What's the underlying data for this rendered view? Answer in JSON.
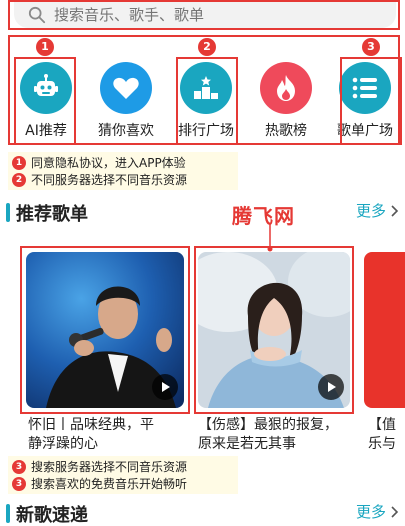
{
  "search": {
    "placeholder": "搜索音乐、歌手、歌单"
  },
  "categories": [
    {
      "label": "AI推荐",
      "badge": "1",
      "color": "#1aa6c0",
      "icon": "robot-icon"
    },
    {
      "label": "猜你喜欢",
      "badge": "",
      "color": "#1e9be6",
      "icon": "heart-icon"
    },
    {
      "label": "排行广场",
      "badge": "2",
      "color": "#1aa6c0",
      "icon": "podium-icon"
    },
    {
      "label": "热歌榜",
      "badge": "",
      "color": "#ef4a5b",
      "icon": "flame-icon"
    },
    {
      "label": "歌单广场",
      "badge": "3",
      "color": "#1aa6c0",
      "icon": "list-icon"
    }
  ],
  "notes_top": [
    {
      "num": "1",
      "text": "同意隐私协议，进入APP体验"
    },
    {
      "num": "2",
      "text": "不同服务器选择不同音乐资源"
    }
  ],
  "recommended": {
    "title": "推荐歌单",
    "more": "更多",
    "cards": [
      {
        "title": "怀旧丨品味经典，平静浮躁的心"
      },
      {
        "title": "【伤感】最狠的报复，原来是若无其事"
      },
      {
        "title": "【值乐与"
      }
    ]
  },
  "watermark": "腾飞网",
  "notes_bottom": [
    {
      "num": "3",
      "text": "搜索服务器选择不同音乐资源"
    },
    {
      "num": "3",
      "text": "搜索喜欢的免费音乐开始畅听"
    }
  ],
  "new_songs": {
    "title": "新歌速递",
    "more": "更多"
  },
  "colors": {
    "accent": "#1aa6c0",
    "annotation": "#e53935"
  }
}
